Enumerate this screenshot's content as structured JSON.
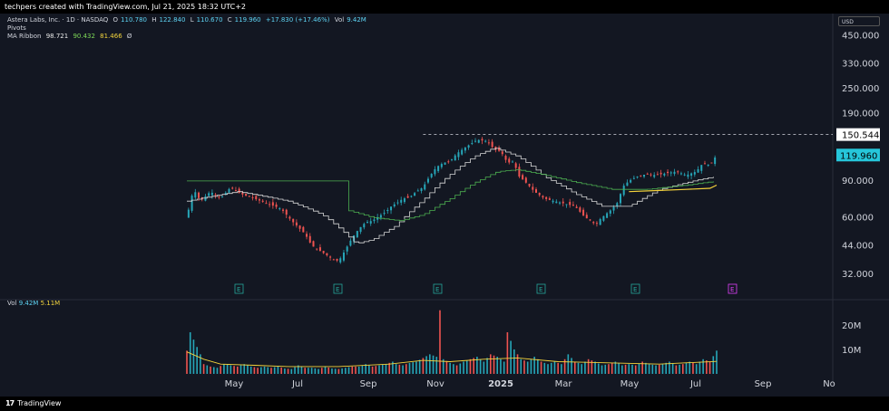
{
  "header": {
    "credit": "techpers created with TradingView.com, Jul 21, 2025 18:32 UTC+2"
  },
  "legend": {
    "symbol": "Astera Labs, Inc. · 1D · NASDAQ",
    "o_label": "O",
    "o": "110.780",
    "h_label": "H",
    "h": "122.840",
    "l_label": "L",
    "l": "110.670",
    "c_label": "C",
    "c": "119.960",
    "change": "+17.830 (+17.46%)",
    "vol_label": "Vol",
    "vol": "9.42M",
    "pivots": "Pivots",
    "ribbon_label": "MA Ribbon",
    "ribbon_1": "98.721",
    "ribbon_2": "90.432",
    "ribbon_3": "81.466",
    "ribbon_4": "Ø"
  },
  "volume_legend": {
    "label": "Vol",
    "value": "9.42M",
    "ma": "5.11M"
  },
  "currency": "USD",
  "footer": {
    "brand": "TradingView"
  },
  "colors": {
    "background": "#131722",
    "up": "#26a6b8",
    "down": "#ef5350",
    "ma_white": "#d8d8d8",
    "ma_green": "#4caf50",
    "ma_yellow": "#f5d33b",
    "last_price_bg": "#26c6da"
  },
  "chart_data": {
    "type": "candlestick",
    "y_scale": "log",
    "price_ticks": [
      "450.000",
      "330.000",
      "250.000",
      "190.000",
      "120.000",
      "90.000",
      "60.000",
      "44.000",
      "32.000"
    ],
    "price_tick_values": [
      450,
      330,
      250,
      190,
      120,
      90,
      60,
      44,
      32
    ],
    "ylim": [
      27,
      520
    ],
    "x_ticks": [
      "May",
      "Jul",
      "Sep",
      "Nov",
      "2025",
      "Mar",
      "May",
      "Jul",
      "Sep",
      "No"
    ],
    "pivot_high": "150.544",
    "last_price": "119.960",
    "earnings_markers": [
      "E",
      "E",
      "E",
      "E",
      "E",
      "E"
    ],
    "volume_ticks": [
      "20M",
      "10M"
    ],
    "volume_tick_values": [
      20,
      10
    ],
    "close_path": [
      [
        0,
        60
      ],
      [
        4,
        82
      ],
      [
        8,
        72
      ],
      [
        14,
        80
      ],
      [
        20,
        74
      ],
      [
        26,
        84
      ],
      [
        32,
        78
      ],
      [
        40,
        74
      ],
      [
        48,
        70
      ],
      [
        56,
        66
      ],
      [
        62,
        58
      ],
      [
        66,
        54
      ],
      [
        70,
        50
      ],
      [
        74,
        44
      ],
      [
        78,
        42
      ],
      [
        82,
        40
      ],
      [
        86,
        38
      ],
      [
        90,
        37
      ],
      [
        94,
        42
      ],
      [
        98,
        48
      ],
      [
        102,
        53
      ],
      [
        106,
        57
      ],
      [
        110,
        58
      ],
      [
        114,
        61
      ],
      [
        118,
        64
      ],
      [
        122,
        69
      ],
      [
        124,
        70
      ],
      [
        128,
        74
      ],
      [
        132,
        75
      ],
      [
        136,
        80
      ],
      [
        140,
        84
      ],
      [
        144,
        95
      ],
      [
        148,
        105
      ],
      [
        152,
        110
      ],
      [
        156,
        112
      ],
      [
        160,
        122
      ],
      [
        166,
        132
      ],
      [
        172,
        142
      ],
      [
        178,
        140
      ],
      [
        182,
        128
      ],
      [
        186,
        125
      ],
      [
        190,
        110
      ],
      [
        194,
        112
      ],
      [
        196,
        96
      ],
      [
        200,
        90
      ],
      [
        206,
        80
      ],
      [
        212,
        74
      ],
      [
        218,
        72
      ],
      [
        224,
        70
      ],
      [
        230,
        68
      ],
      [
        236,
        60
      ],
      [
        240,
        58
      ],
      [
        242,
        55
      ],
      [
        244,
        58
      ],
      [
        248,
        62
      ],
      [
        252,
        66
      ],
      [
        256,
        72
      ],
      [
        258,
        84
      ],
      [
        262,
        90
      ],
      [
        266,
        94
      ],
      [
        272,
        97
      ],
      [
        278,
        96
      ],
      [
        284,
        98
      ],
      [
        290,
        100
      ],
      [
        296,
        96
      ],
      [
        302,
        100
      ],
      [
        306,
        110
      ],
      [
        310,
        107
      ],
      [
        314,
        120
      ]
    ],
    "ma_white": [
      [
        0,
        72
      ],
      [
        30,
        80
      ],
      [
        60,
        72
      ],
      [
        80,
        62
      ],
      [
        100,
        45
      ],
      [
        110,
        47
      ],
      [
        124,
        55
      ],
      [
        140,
        73
      ],
      [
        156,
        97
      ],
      [
        170,
        118
      ],
      [
        182,
        130
      ],
      [
        196,
        118
      ],
      [
        212,
        94
      ],
      [
        230,
        78
      ],
      [
        246,
        68
      ],
      [
        262,
        68
      ],
      [
        280,
        82
      ],
      [
        300,
        90
      ],
      [
        314,
        95
      ]
    ],
    "ma_green": [
      [
        95,
        65
      ],
      [
        110,
        60
      ],
      [
        126,
        58
      ],
      [
        140,
        62
      ],
      [
        156,
        74
      ],
      [
        170,
        88
      ],
      [
        184,
        100
      ],
      [
        196,
        102
      ],
      [
        212,
        96
      ],
      [
        232,
        88
      ],
      [
        252,
        82
      ],
      [
        272,
        82
      ],
      [
        296,
        86
      ],
      [
        314,
        90
      ]
    ],
    "ma_yellow": [
      [
        262,
        80
      ],
      [
        280,
        81
      ],
      [
        296,
        82
      ],
      [
        310,
        83
      ],
      [
        314,
        86
      ]
    ],
    "volume": [
      [
        0,
        9.5
      ],
      [
        2,
        17
      ],
      [
        4,
        14
      ],
      [
        6,
        11
      ],
      [
        8,
        8
      ],
      [
        10,
        4
      ],
      [
        14,
        3
      ],
      [
        18,
        2.5
      ],
      [
        22,
        4
      ],
      [
        26,
        3.5
      ],
      [
        30,
        3
      ],
      [
        34,
        4
      ],
      [
        38,
        3
      ],
      [
        42,
        2.5
      ],
      [
        46,
        3
      ],
      [
        50,
        2.5
      ],
      [
        54,
        3
      ],
      [
        58,
        2.2
      ],
      [
        62,
        2
      ],
      [
        66,
        3.5
      ],
      [
        70,
        2.5
      ],
      [
        74,
        2.5
      ],
      [
        78,
        2
      ],
      [
        82,
        3
      ],
      [
        86,
        2.2
      ],
      [
        90,
        2
      ],
      [
        94,
        2.5
      ],
      [
        98,
        3
      ],
      [
        102,
        3
      ],
      [
        106,
        4
      ],
      [
        110,
        3
      ],
      [
        114,
        3.5
      ],
      [
        118,
        4
      ],
      [
        122,
        5
      ],
      [
        124,
        4
      ],
      [
        128,
        3.5
      ],
      [
        132,
        4.5
      ],
      [
        136,
        5
      ],
      [
        140,
        6.5
      ],
      [
        144,
        8
      ],
      [
        148,
        7
      ],
      [
        150,
        26
      ],
      [
        152,
        6
      ],
      [
        156,
        4.5
      ],
      [
        160,
        3.5
      ],
      [
        164,
        5
      ],
      [
        168,
        6
      ],
      [
        172,
        7
      ],
      [
        176,
        5
      ],
      [
        180,
        8
      ],
      [
        184,
        7
      ],
      [
        188,
        5
      ],
      [
        190,
        17
      ],
      [
        194,
        10
      ],
      [
        198,
        6
      ],
      [
        202,
        5
      ],
      [
        206,
        7
      ],
      [
        210,
        5
      ],
      [
        214,
        4
      ],
      [
        218,
        5
      ],
      [
        222,
        4
      ],
      [
        226,
        8
      ],
      [
        230,
        5
      ],
      [
        234,
        4
      ],
      [
        238,
        6
      ],
      [
        242,
        5
      ],
      [
        246,
        3.5
      ],
      [
        250,
        4
      ],
      [
        254,
        5
      ],
      [
        258,
        3.5
      ],
      [
        262,
        4
      ],
      [
        266,
        3.5
      ],
      [
        270,
        5
      ],
      [
        274,
        4
      ],
      [
        278,
        3.5
      ],
      [
        282,
        4
      ],
      [
        286,
        5
      ],
      [
        290,
        3.5
      ],
      [
        294,
        4
      ],
      [
        298,
        5
      ],
      [
        302,
        4
      ],
      [
        306,
        6
      ],
      [
        310,
        5
      ],
      [
        314,
        9.5
      ]
    ],
    "volume_ma": [
      [
        0,
        9
      ],
      [
        10,
        6
      ],
      [
        20,
        4
      ],
      [
        40,
        3.5
      ],
      [
        60,
        3
      ],
      [
        90,
        3
      ],
      [
        120,
        4
      ],
      [
        140,
        5.5
      ],
      [
        156,
        5
      ],
      [
        176,
        6
      ],
      [
        196,
        6.5
      ],
      [
        220,
        5
      ],
      [
        250,
        4.5
      ],
      [
        280,
        4
      ],
      [
        314,
        5.1
      ]
    ]
  }
}
